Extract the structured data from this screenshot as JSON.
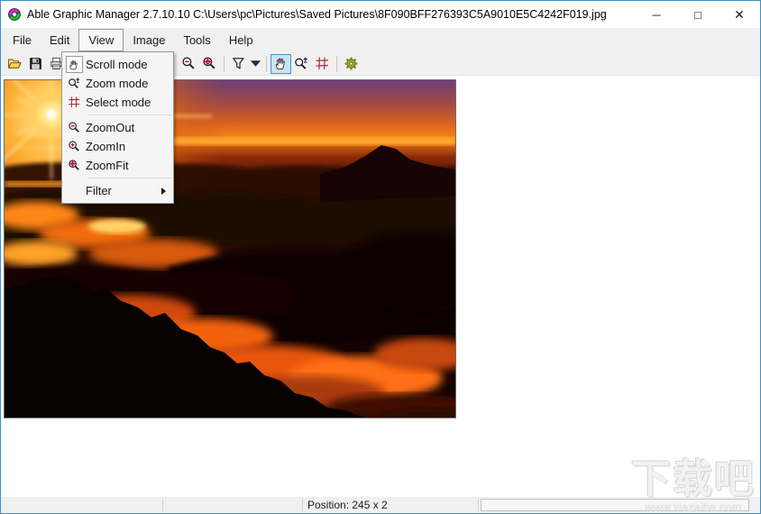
{
  "window": {
    "title": "Able Graphic Manager 2.7.10.10 C:\\Users\\pc\\Pictures\\Saved Pictures\\8F090BFF276393C5A9010E5C4242F019.jpg",
    "border_color": "#3b8fc6",
    "controls": {
      "minimize": "─",
      "maximize": "□",
      "close": "✕"
    }
  },
  "menu_bar": {
    "items": [
      {
        "label": "File"
      },
      {
        "label": "Edit"
      },
      {
        "label": "View",
        "open": true
      },
      {
        "label": "Image"
      },
      {
        "label": "Tools"
      },
      {
        "label": "Help"
      }
    ]
  },
  "toolbar": {
    "left_buttons": [
      {
        "name": "open",
        "icon": "open-folder-icon"
      },
      {
        "name": "save",
        "icon": "save-icon"
      },
      {
        "name": "print",
        "icon": "print-icon"
      }
    ],
    "right_buttons": [
      {
        "name": "zoom-out",
        "icon": "zoom-out-icon"
      },
      {
        "name": "zoom-fit",
        "icon": "zoom-fit-icon"
      },
      {
        "name": "filter",
        "icon": "funnel-icon"
      },
      {
        "name": "filter-dropdown",
        "icon": "chevron-down-icon"
      },
      {
        "name": "scroll-mode",
        "icon": "hand-icon",
        "active": true
      },
      {
        "name": "zoom-mode",
        "icon": "zoom-mode-icon"
      },
      {
        "name": "select-mode",
        "icon": "select-mode-icon"
      },
      {
        "name": "settings",
        "icon": "gear-icon"
      }
    ],
    "active_color": "#cbe3f7"
  },
  "view_menu": {
    "items": [
      {
        "label": "Scroll mode",
        "icon": "hand-icon",
        "selected": true
      },
      {
        "label": "Zoom mode",
        "icon": "zoom-mode-icon"
      },
      {
        "label": "Select mode",
        "icon": "select-mode-icon"
      },
      {
        "separator": true
      },
      {
        "label": "ZoomOut",
        "icon": "zoom-out-icon"
      },
      {
        "label": "ZoomIn",
        "icon": "zoom-in-icon"
      },
      {
        "label": "ZoomFit",
        "icon": "zoom-fit-icon"
      },
      {
        "separator": true
      },
      {
        "label": "Filter",
        "submenu": true
      }
    ]
  },
  "status_bar": {
    "position": "Position: 245 x 2"
  },
  "watermark": {
    "title": "下载吧",
    "site": "www.xiazaiba.com"
  },
  "photo": {
    "subject": "sunset-above-sea-of-clouds",
    "palette": {
      "sky_purple": "#6e3f74",
      "sky_orange": "#ef6f16",
      "horizon_glow": "#ffb031",
      "cloud_fire": "#ff7014",
      "silhouette": "#070101"
    }
  }
}
